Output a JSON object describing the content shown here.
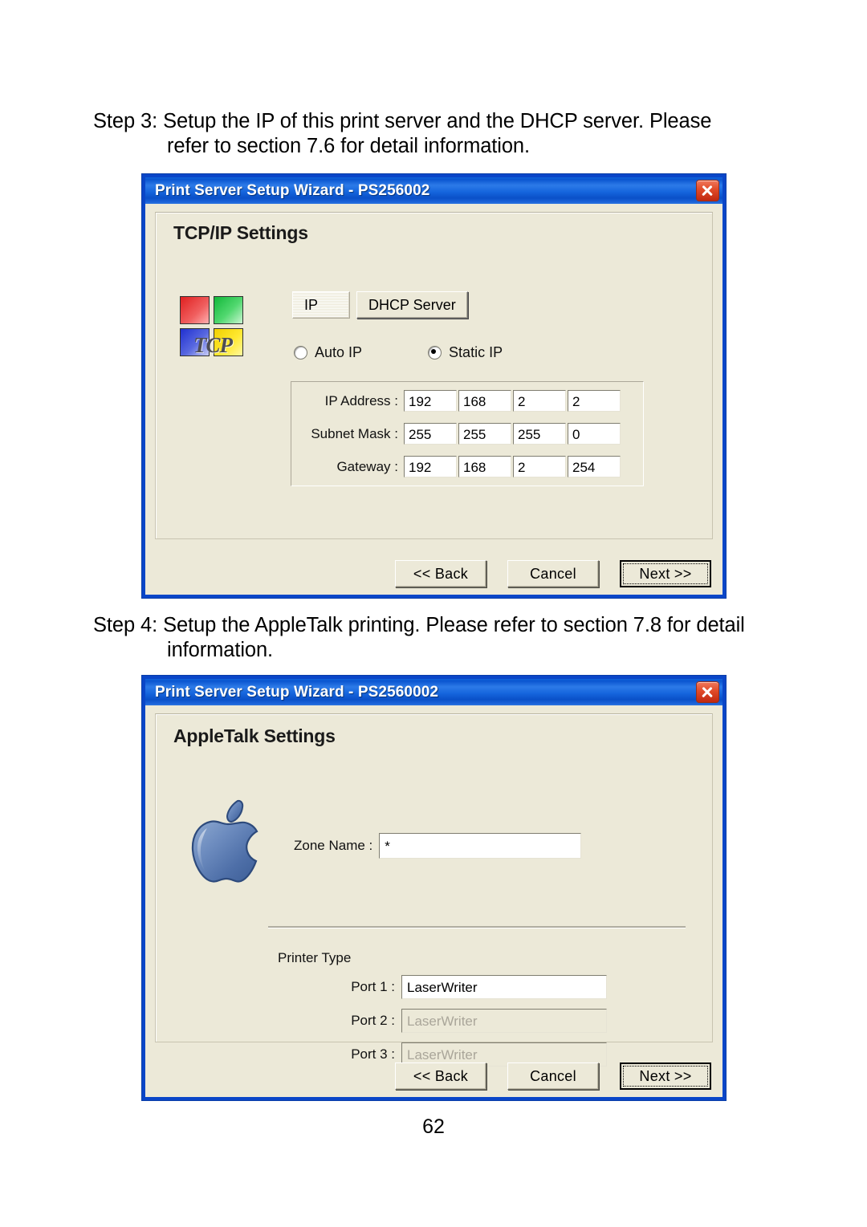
{
  "page": {
    "number": "62"
  },
  "steps": [
    {
      "line1": "Step 3: Setup the IP of this print server and the DHCP server. Please",
      "line2": "refer to section 7.6 for detail information."
    },
    {
      "line1": "Step 4: Setup the AppleTalk printing. Please refer to section 7.8 for detail",
      "line2": "information."
    }
  ],
  "colors": {
    "titlebar_blue": "#0a55d0",
    "dialog_face": "#ece9d8",
    "close_red": "#c02810"
  },
  "dialog_tcpip": {
    "title": "Print Server Setup Wizard - PS256002",
    "close_icon": "close-icon",
    "panel_title": "TCP/IP Settings",
    "icon_label": "TCP",
    "tabs": [
      {
        "label": "IP",
        "selected": true
      },
      {
        "label": "DHCP Server",
        "selected": false
      }
    ],
    "radios": [
      {
        "label": "Auto IP",
        "checked": false
      },
      {
        "label": "Static IP",
        "checked": true
      }
    ],
    "ip_rows": [
      {
        "label": "IP Address :",
        "octets": [
          "192",
          "168",
          "2",
          "2"
        ]
      },
      {
        "label": "Subnet Mask :",
        "octets": [
          "255",
          "255",
          "255",
          "0"
        ]
      },
      {
        "label": "Gateway :",
        "octets": [
          "192",
          "168",
          "2",
          "254"
        ]
      }
    ],
    "buttons": [
      {
        "label": "<< Back",
        "default": false
      },
      {
        "label": "Cancel",
        "default": false
      },
      {
        "label": "Next >>",
        "default": true
      }
    ]
  },
  "dialog_appletalk": {
    "title": "Print Server Setup Wizard - PS2560002",
    "close_icon": "close-icon",
    "panel_title": "AppleTalk Settings",
    "zone": {
      "label": "Zone Name :",
      "value": "*"
    },
    "printer_type_label": "Printer Type",
    "ports": [
      {
        "label": "Port 1 :",
        "value": "LaserWriter",
        "enabled": true
      },
      {
        "label": "Port 2 :",
        "value": "LaserWriter",
        "enabled": false
      },
      {
        "label": "Port 3 :",
        "value": "LaserWriter",
        "enabled": false
      }
    ],
    "buttons": [
      {
        "label": "<< Back",
        "default": false
      },
      {
        "label": "Cancel",
        "default": false
      },
      {
        "label": "Next >>",
        "default": true
      }
    ]
  }
}
